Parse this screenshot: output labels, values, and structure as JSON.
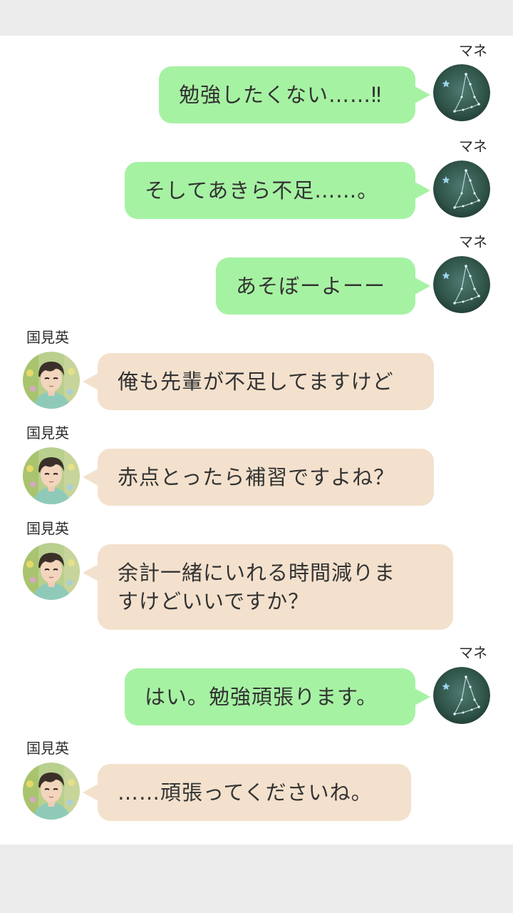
{
  "colors": {
    "my_bubble": "#a6f2a3",
    "their_bubble": "#f3e1cd",
    "background": "#ffffff",
    "frame": "#ececec",
    "text": "#333333"
  },
  "messages": [
    {
      "sender": "マネ",
      "side": "right",
      "text": "勉強したくない……‼︎",
      "avatar": "constellation-avatar"
    },
    {
      "sender": "マネ",
      "side": "right",
      "text": "そしてあきら不足……。",
      "avatar": "constellation-avatar"
    },
    {
      "sender": "マネ",
      "side": "right",
      "text": "あそぼーよーー",
      "avatar": "constellation-avatar"
    },
    {
      "sender": "国見英",
      "side": "left",
      "text": "俺も先輩が不足してますけど",
      "avatar": "character-avatar"
    },
    {
      "sender": "国見英",
      "side": "left",
      "text": "赤点とったら補習ですよね？",
      "avatar": "character-avatar"
    },
    {
      "sender": "国見英",
      "side": "left",
      "text": "余計一緒にいれる時間減りま\nすけどいいですか？",
      "avatar": "character-avatar"
    },
    {
      "sender": "マネ",
      "side": "right",
      "text": "はい。勉強頑張ります。",
      "avatar": "constellation-avatar"
    },
    {
      "sender": "国見英",
      "side": "left",
      "text": "……頑張ってくださいね。",
      "avatar": "character-avatar"
    }
  ]
}
